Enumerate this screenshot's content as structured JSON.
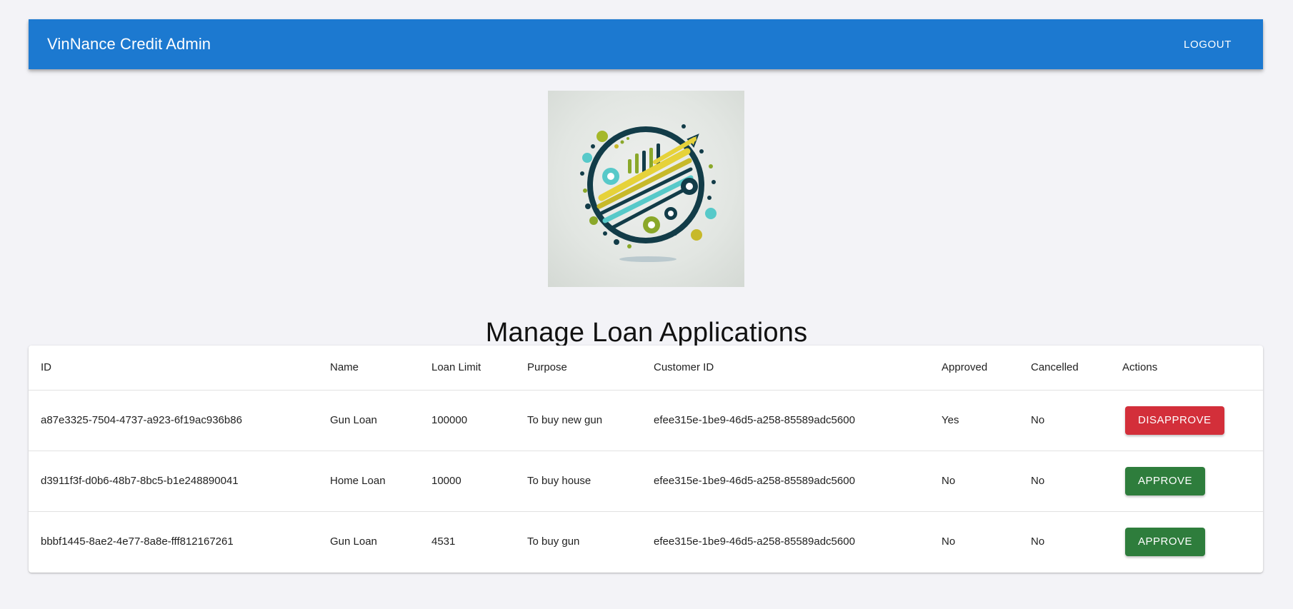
{
  "appbar": {
    "title": "VinNance Credit Admin",
    "logout_label": "LOGOUT"
  },
  "page": {
    "title": "Manage Loan Applications"
  },
  "colors": {
    "primary": "#1c79d0",
    "approve": "#2e7d3c",
    "disapprove": "#d32f3a"
  },
  "table": {
    "headers": [
      "ID",
      "Name",
      "Loan Limit",
      "Purpose",
      "Customer ID",
      "Approved",
      "Cancelled",
      "Actions"
    ],
    "rows": [
      {
        "id": "a87e3325-7504-4737-a923-6f19ac936b86",
        "name": "Gun Loan",
        "loan_limit": "100000",
        "purpose": "To buy new gun",
        "customer_id": "efee315e-1be9-46d5-a258-85589adc5600",
        "approved": "Yes",
        "cancelled": "No",
        "action": "DISAPPROVE"
      },
      {
        "id": "d3911f3f-d0b6-48b7-8bc5-b1e248890041",
        "name": "Home Loan",
        "loan_limit": "10000",
        "purpose": "To buy house",
        "customer_id": "efee315e-1be9-46d5-a258-85589adc5600",
        "approved": "No",
        "cancelled": "No",
        "action": "APPROVE"
      },
      {
        "id": "bbbf1445-8ae2-4e77-8a8e-fff812167261",
        "name": "Gun Loan",
        "loan_limit": "4531",
        "purpose": "To buy gun",
        "customer_id": "efee315e-1be9-46d5-a258-85589adc5600",
        "approved": "No",
        "cancelled": "No",
        "action": "APPROVE"
      }
    ]
  }
}
